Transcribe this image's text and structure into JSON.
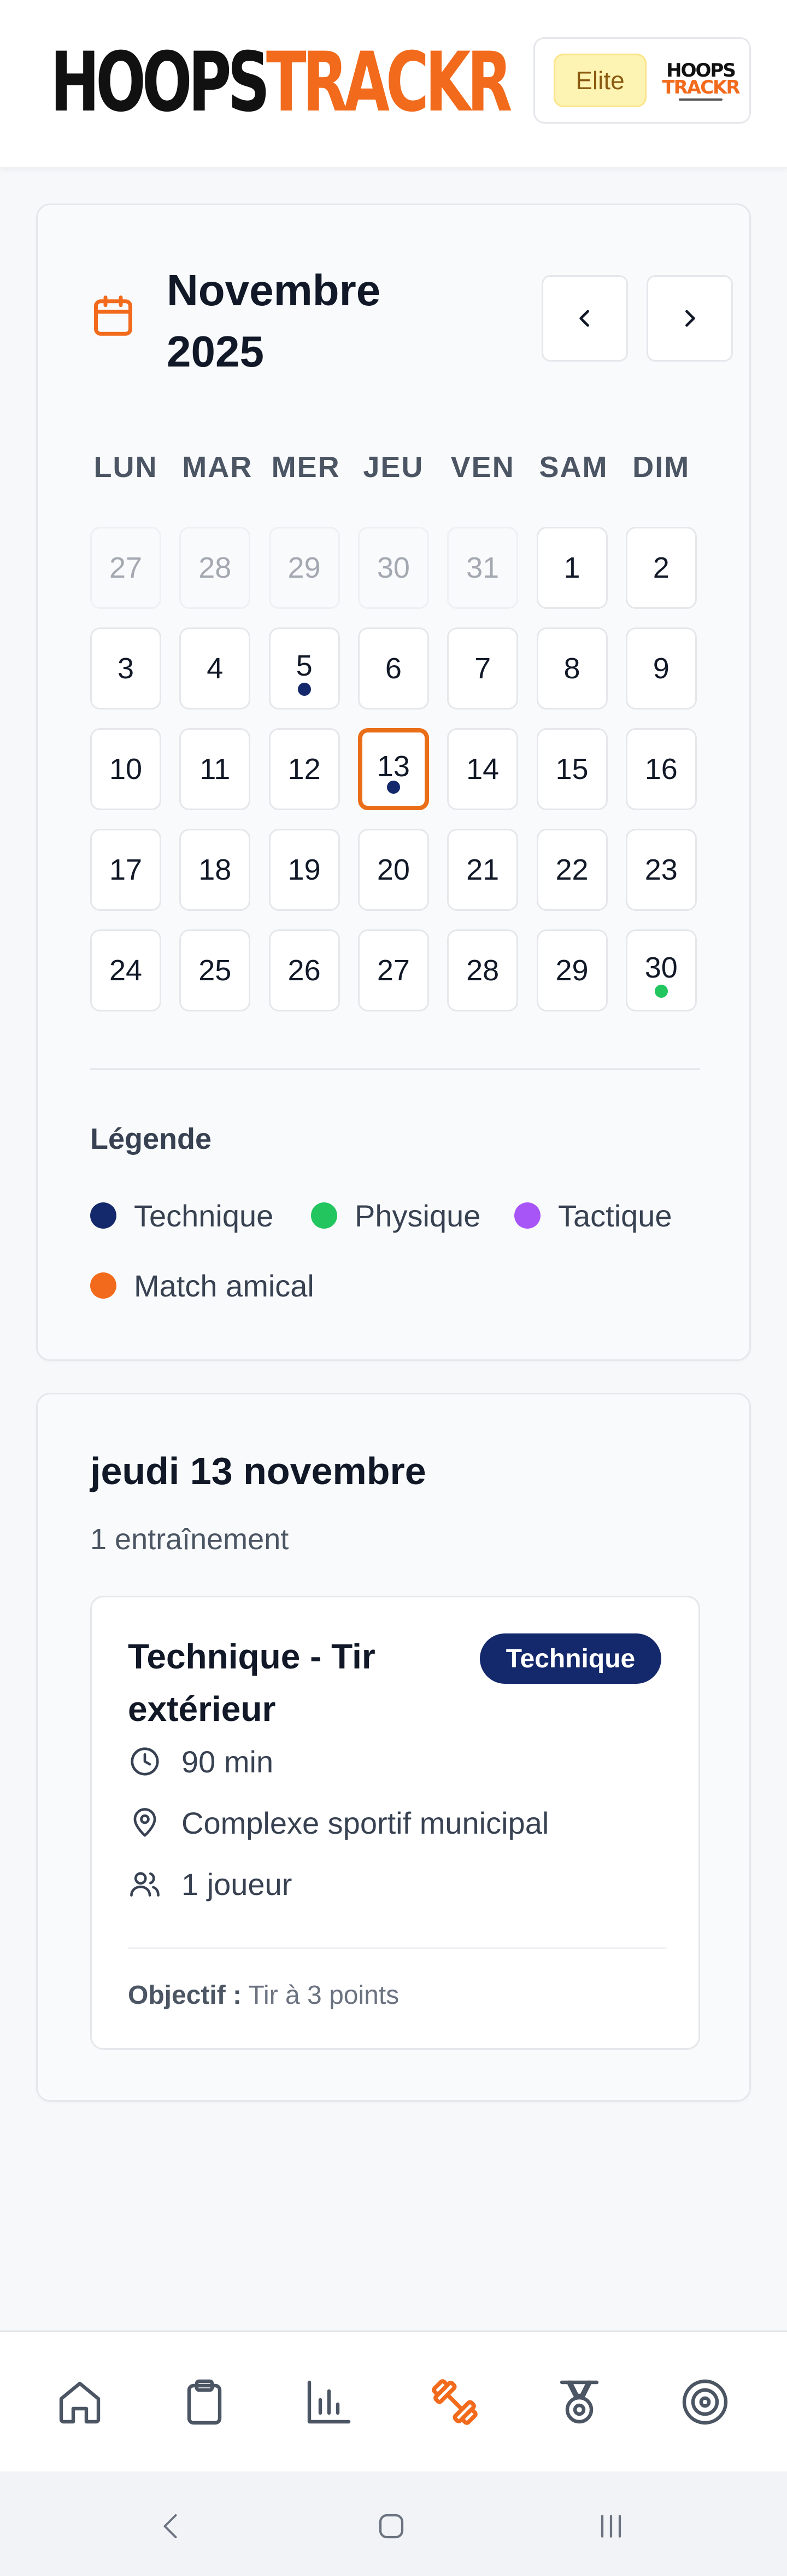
{
  "header": {
    "logo_part1": "HOOPS",
    "logo_part2": "TRACKR",
    "plan_label": "Elite",
    "avatar_line1": "HOOPS",
    "avatar_line2": "TRACKR"
  },
  "calendar": {
    "month_title": "Novembre 2025",
    "weekdays": [
      "LUN",
      "MAR",
      "MER",
      "JEU",
      "VEN",
      "SAM",
      "DIM"
    ],
    "weeks": [
      [
        {
          "d": "27",
          "muted": true
        },
        {
          "d": "28",
          "muted": true
        },
        {
          "d": "29",
          "muted": true
        },
        {
          "d": "30",
          "muted": true
        },
        {
          "d": "31",
          "muted": true
        },
        {
          "d": "1"
        },
        {
          "d": "2"
        }
      ],
      [
        {
          "d": "3"
        },
        {
          "d": "4"
        },
        {
          "d": "5",
          "dot": "technique"
        },
        {
          "d": "6"
        },
        {
          "d": "7"
        },
        {
          "d": "8"
        },
        {
          "d": "9"
        }
      ],
      [
        {
          "d": "10"
        },
        {
          "d": "11"
        },
        {
          "d": "12"
        },
        {
          "d": "13",
          "dot": "technique",
          "selected": true
        },
        {
          "d": "14"
        },
        {
          "d": "15"
        },
        {
          "d": "16"
        }
      ],
      [
        {
          "d": "17"
        },
        {
          "d": "18"
        },
        {
          "d": "19"
        },
        {
          "d": "20"
        },
        {
          "d": "21"
        },
        {
          "d": "22"
        },
        {
          "d": "23"
        }
      ],
      [
        {
          "d": "24"
        },
        {
          "d": "25"
        },
        {
          "d": "26"
        },
        {
          "d": "27"
        },
        {
          "d": "28"
        },
        {
          "d": "29"
        },
        {
          "d": "30",
          "dot": "physique"
        }
      ]
    ],
    "legend_title": "Légende",
    "legend": [
      {
        "key": "technique",
        "label": "Technique",
        "color": "#14296b"
      },
      {
        "key": "physique",
        "label": "Physique",
        "color": "#22c55e"
      },
      {
        "key": "tactique",
        "label": "Tactique",
        "color": "#a855f7"
      },
      {
        "key": "match",
        "label": "Match amical",
        "color": "#f26a1b"
      }
    ]
  },
  "day_detail": {
    "title": "jeudi 13 novembre",
    "subtitle": "1 entraînement",
    "session": {
      "title": "Technique - Tir extérieur",
      "tag": "Technique",
      "duration": "90 min",
      "location": "Complexe sportif municipal",
      "players": "1 joueur",
      "objective_label": "Objectif :",
      "objective_value": "Tir à 3 points"
    }
  },
  "bottom_nav": [
    "home-icon",
    "clipboard-icon",
    "stats-icon",
    "training-icon",
    "medal-icon",
    "target-icon"
  ],
  "colors": {
    "accent": "#f26a1b",
    "technique": "#14296b",
    "physique": "#22c55e",
    "tactique": "#a855f7",
    "match": "#f26a1b"
  }
}
